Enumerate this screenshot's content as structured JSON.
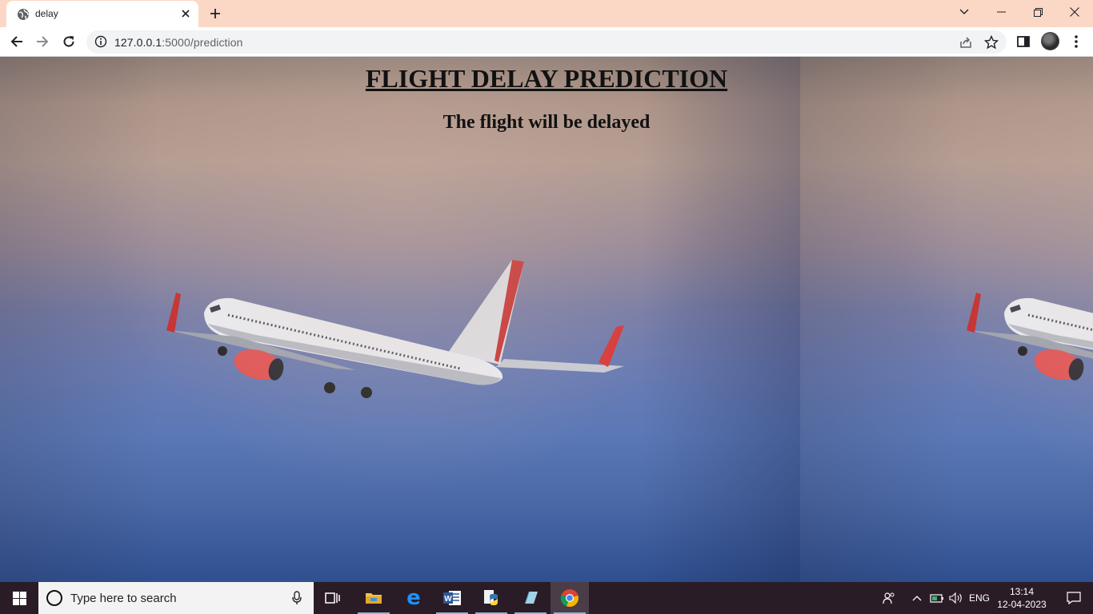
{
  "browser": {
    "tab_title": "delay",
    "url_host": "127.0.0.1",
    "url_path": ":5000/prediction",
    "icons": [
      "globe-icon",
      "close-icon",
      "plus-icon",
      "chevron-down-icon",
      "minimize-icon",
      "restore-icon",
      "window-close-icon",
      "back-icon",
      "forward-icon",
      "reload-icon",
      "info-icon",
      "share-icon",
      "star-icon",
      "side-panel-icon",
      "avatar",
      "more-vert-icon"
    ]
  },
  "page": {
    "heading": "FLIGHT DELAY PREDICTION",
    "result": "The flight will be delayed"
  },
  "taskbar": {
    "search_placeholder": "Type here to search",
    "apps": [
      "task-view",
      "file-explorer",
      "edge",
      "word",
      "python",
      "notepad",
      "chrome"
    ],
    "language": "ENG",
    "time": "13:14",
    "date": "12-04-2023"
  },
  "colors": {
    "tabbar": "#fbd8c5",
    "taskbar": "#2a1c26",
    "plane_accent": "#d93a3a"
  }
}
